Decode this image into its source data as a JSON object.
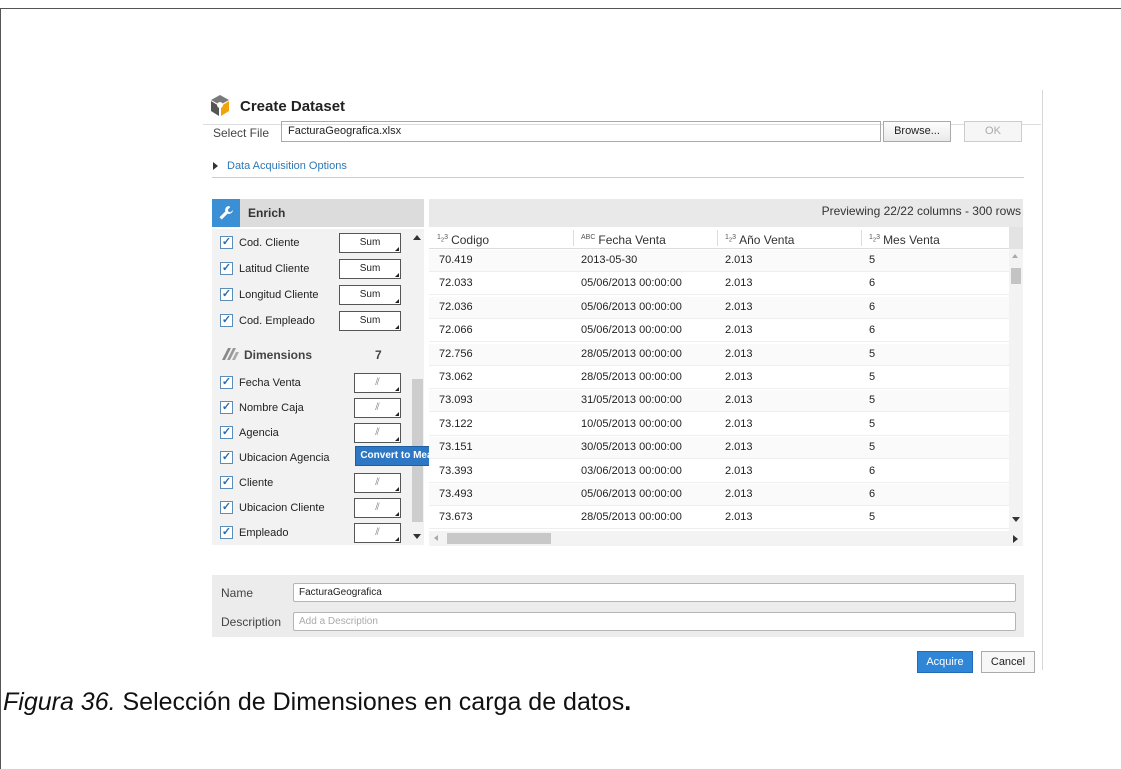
{
  "dialog": {
    "title": "Create Dataset",
    "select_file_label": "Select File",
    "file_value": "FacturaGeografica.xlsx",
    "browse_label": "Browse...",
    "ok_label": "OK",
    "data_acquisition_label": "Data Acquisition Options"
  },
  "enrich": {
    "header": "Enrich",
    "measures": [
      {
        "label": "Cod. Cliente",
        "agg": "Sum"
      },
      {
        "label": "Latitud Cliente",
        "agg": "Sum"
      },
      {
        "label": "Longitud Cliente",
        "agg": "Sum"
      },
      {
        "label": "Cod. Empleado",
        "agg": "Sum"
      }
    ],
    "dimensions_label": "Dimensions",
    "dimensions_count": "7",
    "dimensions": [
      {
        "label": "Fecha Venta"
      },
      {
        "label": "Nombre Caja"
      },
      {
        "label": "Agencia"
      },
      {
        "label": "Ubicacion Agencia"
      },
      {
        "label": "Cliente"
      },
      {
        "label": "Ubicacion Cliente"
      },
      {
        "label": "Empleado"
      }
    ],
    "tooltip": "Convert to Measure"
  },
  "grid": {
    "preview_text": "Previewing 22/22 columns - 300 rows",
    "columns": [
      {
        "type": "123",
        "name": "Codigo"
      },
      {
        "type": "ABC",
        "name": "Fecha Venta"
      },
      {
        "type": "123",
        "name": "Año Venta"
      },
      {
        "type": "123",
        "name": "Mes Venta"
      }
    ],
    "rows": [
      [
        "70.419",
        "2013-05-30",
        "2.013",
        "5"
      ],
      [
        "72.033",
        "05/06/2013 00:00:00",
        "2.013",
        "6"
      ],
      [
        "72.036",
        "05/06/2013 00:00:00",
        "2.013",
        "6"
      ],
      [
        "72.066",
        "05/06/2013 00:00:00",
        "2.013",
        "6"
      ],
      [
        "72.756",
        "28/05/2013 00:00:00",
        "2.013",
        "5"
      ],
      [
        "73.062",
        "28/05/2013 00:00:00",
        "2.013",
        "5"
      ],
      [
        "73.093",
        "31/05/2013 00:00:00",
        "2.013",
        "5"
      ],
      [
        "73.122",
        "10/05/2013 00:00:00",
        "2.013",
        "5"
      ],
      [
        "73.151",
        "30/05/2013 00:00:00",
        "2.013",
        "5"
      ],
      [
        "73.393",
        "03/06/2013 00:00:00",
        "2.013",
        "6"
      ],
      [
        "73.493",
        "05/06/2013 00:00:00",
        "2.013",
        "6"
      ],
      [
        "73.673",
        "28/05/2013 00:00:00",
        "2.013",
        "5"
      ]
    ]
  },
  "form": {
    "name_label": "Name",
    "name_value": "FacturaGeografica",
    "description_label": "Description",
    "description_placeholder": "Add a Description"
  },
  "buttons": {
    "acquire": "Acquire",
    "cancel": "Cancel"
  },
  "caption": {
    "prefix": "Figura 36.",
    "text": " Selección de Dimensiones en carga de datos",
    "suffix": "."
  },
  "colors": {
    "accent": "#2f86d6",
    "enrich_icon_bg": "#3b8fd4"
  }
}
